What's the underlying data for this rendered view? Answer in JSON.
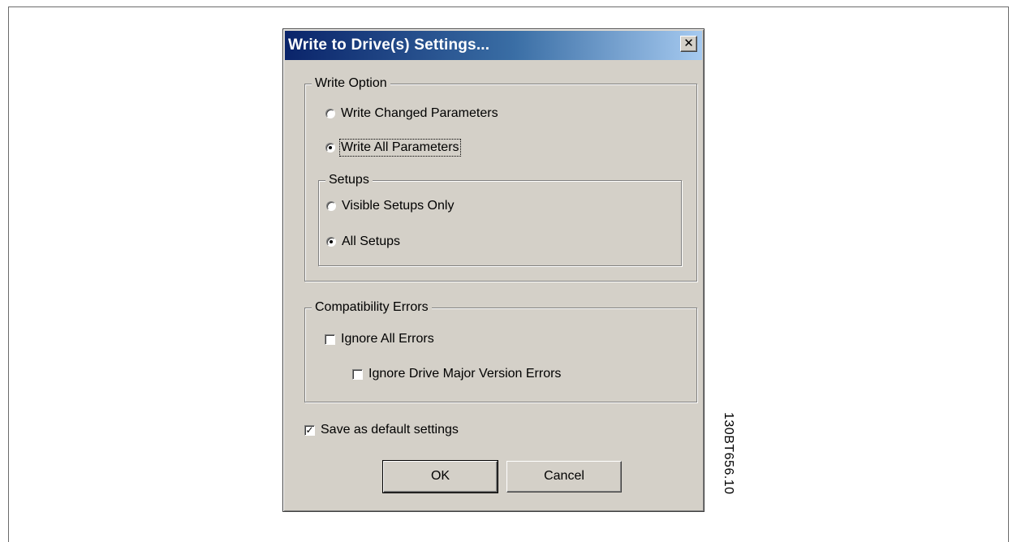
{
  "dialog": {
    "title": "Write to Drive(s) Settings...",
    "close_glyph": "✕"
  },
  "write_option": {
    "label": "Write Option",
    "options": [
      {
        "label": "Write Changed Parameters",
        "checked": false
      },
      {
        "label": "Write All Parameters",
        "checked": true
      }
    ]
  },
  "setups": {
    "label": "Setups",
    "options": [
      {
        "label": "Visible Setups Only",
        "checked": false
      },
      {
        "label": "All Setups",
        "checked": true
      }
    ]
  },
  "compatibility": {
    "label": "Compatibility Errors",
    "ignore_all": {
      "label": "Ignore All Errors",
      "checked": false
    },
    "ignore_major": {
      "label": "Ignore Drive Major Version Errors",
      "checked": false
    }
  },
  "save_default": {
    "label": "Save as default settings",
    "checked": true
  },
  "buttons": {
    "ok": "OK",
    "cancel": "Cancel"
  },
  "figure_code": "130BT656.10",
  "colors": {
    "dialog_bg": "#d4d0c8",
    "title_start": "#0a246a",
    "title_end": "#a6caf0"
  }
}
